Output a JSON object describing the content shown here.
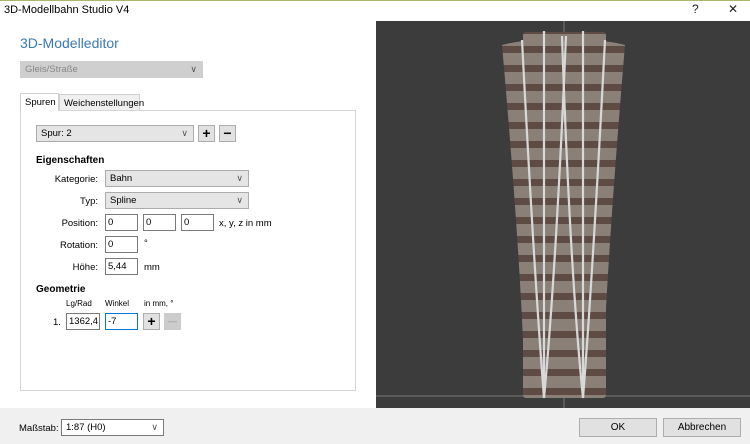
{
  "window": {
    "title": "3D-Modellbahn Studio V4",
    "help_label": "?",
    "close_label": "✕"
  },
  "editor": {
    "heading": "3D-Modelleditor",
    "type_select": "Gleis/Straße"
  },
  "tabs": [
    {
      "label": "Spuren",
      "active": true
    },
    {
      "label": "Weichenstellungen",
      "active": false
    }
  ],
  "track": {
    "select": "Spur: 2",
    "add_label": "+",
    "remove_label": "−"
  },
  "properties": {
    "heading": "Eigenschaften",
    "kategorie_label": "Kategorie:",
    "kategorie_value": "Bahn",
    "typ_label": "Typ:",
    "typ_value": "Spline",
    "position_label": "Position:",
    "position": [
      "0",
      "0",
      "0"
    ],
    "position_unit": "x, y, z in mm",
    "rotation_label": "Rotation:",
    "rotation": "0",
    "rotation_unit": "°",
    "hoehe_label": "Höhe:",
    "hoehe": "5,44",
    "hoehe_unit": "mm"
  },
  "geometry": {
    "heading": "Geometrie",
    "col_length": "Lg/Rad",
    "col_angle": "Winkel",
    "col_unit": "in mm, °",
    "rows": [
      {
        "index": "1.",
        "length": "1362,4",
        "angle": "-7"
      }
    ],
    "add_label": "+",
    "remove_label": "—"
  },
  "footer": {
    "scale_label": "Maßstab:",
    "scale_value": "1:87 (H0)",
    "ok_label": "OK",
    "cancel_label": "Abbrechen"
  },
  "colors": {
    "accent": "#3b7ab8",
    "viewport_bg": "#3c3c3c",
    "focus": "#0078d7"
  }
}
